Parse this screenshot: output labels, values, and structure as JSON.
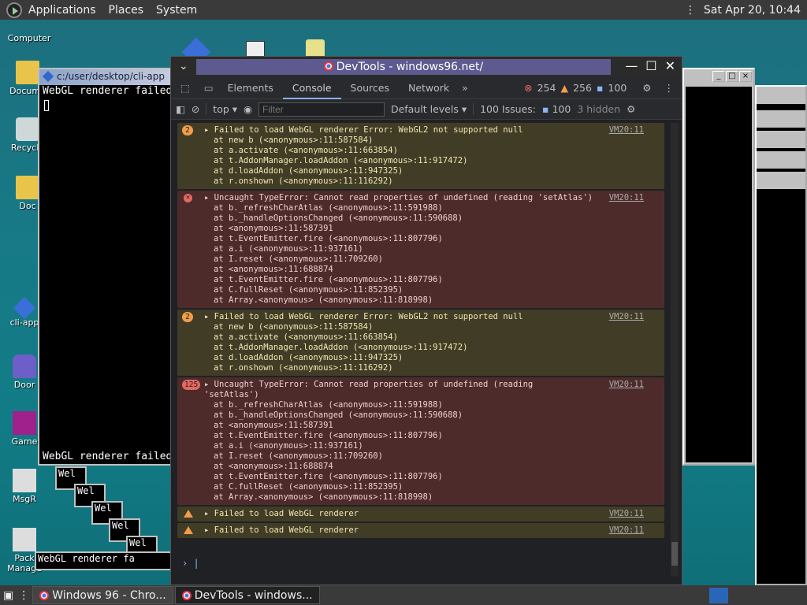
{
  "topbar": {
    "menus": [
      "Applications",
      "Places",
      "System"
    ],
    "clock": "Sat Apr 20, 10:44"
  },
  "desktop_icons": [
    "Computer",
    "Docume",
    "Recycle",
    "Doc",
    "cli-app",
    "Door",
    "Game",
    "MsgR",
    "Pack Manage"
  ],
  "terminal": {
    "title": "c:/user/desktop/cli-app",
    "line1": "WebGL renderer failed",
    "line2": "WebGL renderer failed",
    "stack_snips": [
      "Wel",
      "Wel",
      "Wel",
      "Wel",
      "Wel",
      "WebGL renderer fa"
    ]
  },
  "devtools": {
    "window_title": "DevTools - windows96.net/",
    "tabs": [
      "Elements",
      "Console",
      "Sources",
      "Network"
    ],
    "error_count": "254",
    "warning_count": "256",
    "info_count": "100",
    "context": "top",
    "filter_placeholder": "Filter",
    "levels": "Default levels",
    "issues_label": "100 Issues:",
    "issues_count": "100",
    "hidden": "3 hidden",
    "entries": [
      {
        "kind": "warn",
        "badge": "2",
        "head": "Failed to load WebGL renderer Error: WebGL2 not supported null",
        "stack": [
          "at new b (<anonymous>:11:587584)",
          "at a.activate (<anonymous>:11:663854)",
          "at t.AddonManager.loadAddon (<anonymous>:11:917472)",
          "at d.loadAddon (<anonymous>:11:947325)",
          "at r.onshown (<anonymous>:11:116292)"
        ],
        "src": "VM20:11"
      },
      {
        "kind": "err",
        "badge": "",
        "head": "Uncaught TypeError: Cannot read properties of undefined (reading 'setAtlas')",
        "stack": [
          "at b._refreshCharAtlas (<anonymous>:11:591988)",
          "at b._handleOptionsChanged (<anonymous>:11:590688)",
          "at <anonymous>:11:587391",
          "at t.EventEmitter.fire (<anonymous>:11:807796)",
          "at a.i (<anonymous>:11:937161)",
          "at I.reset (<anonymous>:11:709260)",
          "at <anonymous>:11:688874",
          "at t.EventEmitter.fire (<anonymous>:11:807796)",
          "at C.fullReset (<anonymous>:11:852395)",
          "at Array.<anonymous> (<anonymous>:11:818998)"
        ],
        "src": "VM20:11"
      },
      {
        "kind": "warn",
        "badge": "2",
        "head": "Failed to load WebGL renderer Error: WebGL2 not supported null",
        "stack": [
          "at new b (<anonymous>:11:587584)",
          "at a.activate (<anonymous>:11:663854)",
          "at t.AddonManager.loadAddon (<anonymous>:11:917472)",
          "at d.loadAddon (<anonymous>:11:947325)",
          "at r.onshown (<anonymous>:11:116292)"
        ],
        "src": "VM20:11"
      },
      {
        "kind": "err",
        "badge": "125",
        "head": "Uncaught TypeError: Cannot read properties of undefined (reading\n'setAtlas')",
        "stack": [
          "at b._refreshCharAtlas (<anonymous>:11:591988)",
          "at b._handleOptionsChanged (<anonymous>:11:590688)",
          "at <anonymous>:11:587391",
          "at t.EventEmitter.fire (<anonymous>:11:807796)",
          "at a.i (<anonymous>:11:937161)",
          "at I.reset (<anonymous>:11:709260)",
          "at <anonymous>:11:688874",
          "at t.EventEmitter.fire (<anonymous>:11:807796)",
          "at C.fullReset (<anonymous>:11:852395)",
          "at Array.<anonymous> (<anonymous>:11:818998)"
        ],
        "src": "VM20:11"
      },
      {
        "kind": "warnline",
        "badge": "",
        "head": "Failed to load WebGL renderer",
        "stack": [],
        "src": "VM20:11"
      },
      {
        "kind": "warnline",
        "badge": "",
        "head": "Failed to load WebGL renderer",
        "stack": [],
        "src": "VM20:11"
      }
    ]
  },
  "taskbar": {
    "tasks": [
      "Windows 96 - Chro...",
      "DevTools - windows..."
    ]
  }
}
